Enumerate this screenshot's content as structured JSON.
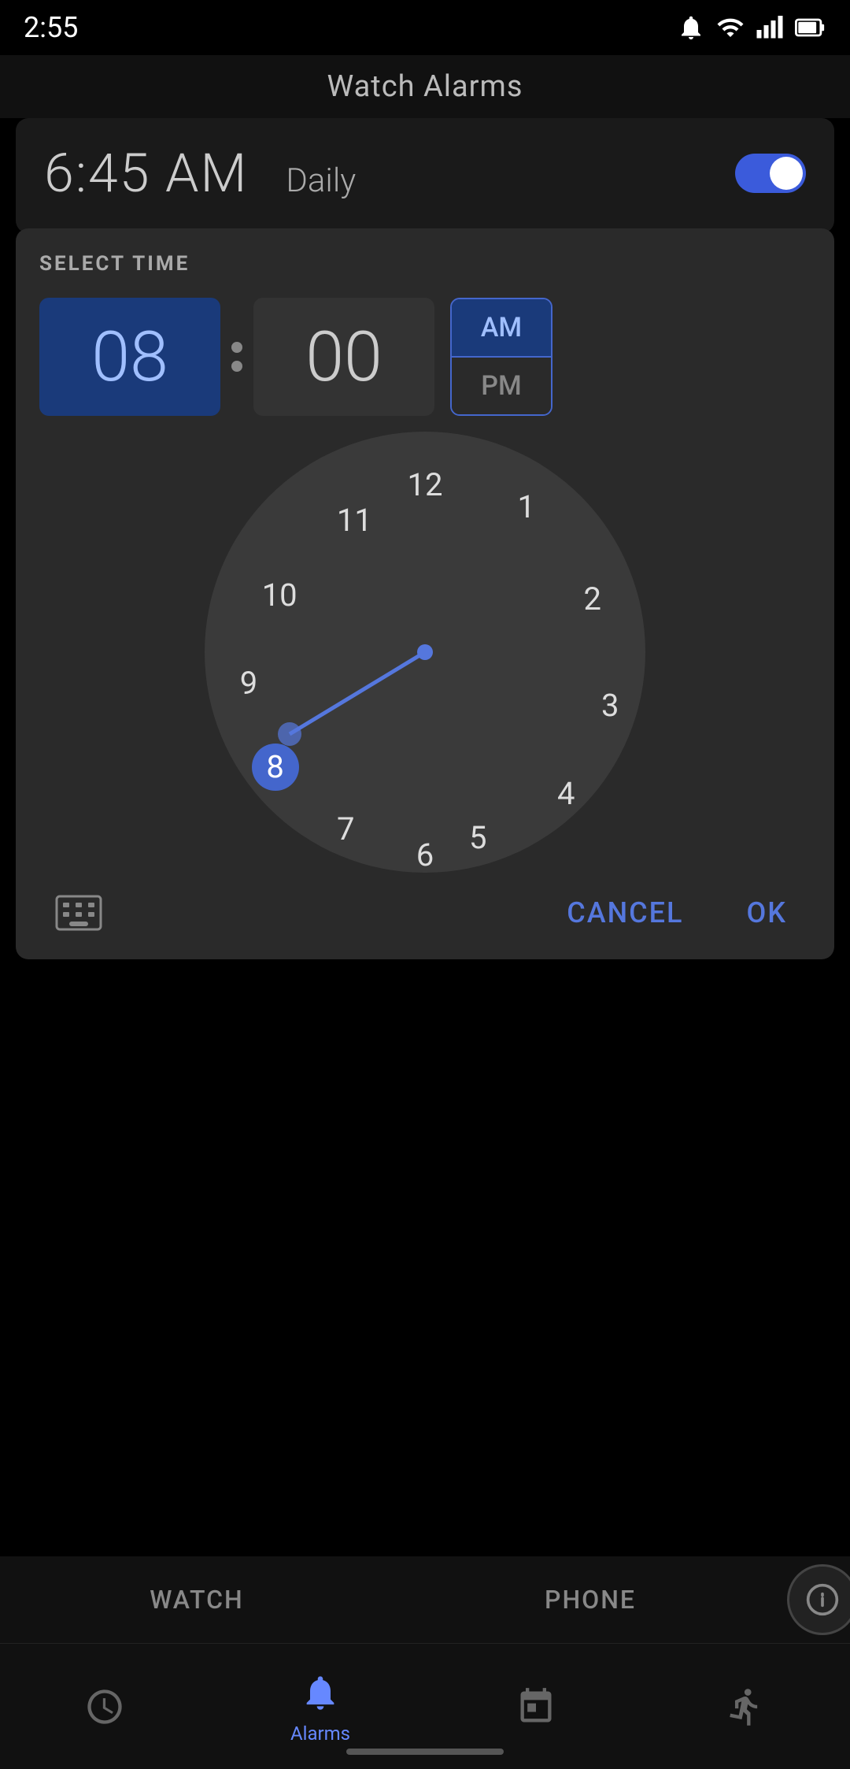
{
  "statusBar": {
    "time": "2:55",
    "icons": [
      "notification",
      "wifi",
      "signal",
      "battery"
    ]
  },
  "pageTitle": "Watch Alarms",
  "alarmCard": {
    "time": "6:45 AM",
    "label": "Daily",
    "toggleEnabled": true
  },
  "timePicker": {
    "sectionLabel": "SELECT TIME",
    "hour": "08",
    "minute": "00",
    "ampm": {
      "options": [
        "AM",
        "PM"
      ],
      "selected": "AM"
    },
    "clockNumbers": [
      "12",
      "1",
      "2",
      "3",
      "4",
      "5",
      "6",
      "7",
      "8",
      "9",
      "10",
      "11"
    ],
    "selectedHour": 8,
    "cancelLabel": "CANCEL",
    "okLabel": "OK"
  },
  "bottomTabs": {
    "watchLabel": "WATCH",
    "phoneLabel": "PHONE"
  },
  "navBar": {
    "items": [
      {
        "icon": "clock-icon",
        "label": "",
        "active": false
      },
      {
        "icon": "alarm-icon",
        "label": "Alarms",
        "active": true
      },
      {
        "icon": "calendar-icon",
        "label": "",
        "active": false
      },
      {
        "icon": "activity-icon",
        "label": "",
        "active": false
      }
    ]
  }
}
